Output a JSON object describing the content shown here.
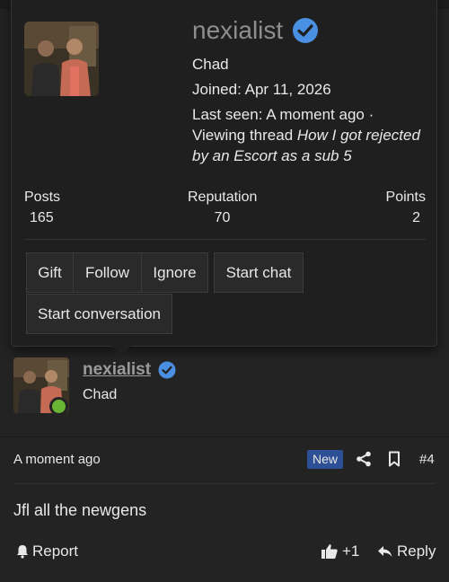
{
  "popup": {
    "username": "nexialist",
    "user_title": "Chad",
    "joined": "Joined: Apr 11, 2026",
    "last_seen_prefix": "Last seen: A moment ago ·",
    "viewing_prefix": "Viewing thread",
    "viewing_thread_line1": "How I got rejected",
    "viewing_thread_line2": "by an Escort as a sub 5",
    "stats": [
      {
        "label": "Posts",
        "value": "165"
      },
      {
        "label": "Reputation",
        "value": "70"
      },
      {
        "label": "Points",
        "value": "2"
      }
    ],
    "buttons": {
      "gift": "Gift",
      "follow": "Follow",
      "ignore": "Ignore",
      "start_chat": "Start chat",
      "start_conversation": "Start conversation"
    }
  },
  "post": {
    "username": "nexialist",
    "user_title": "Chad",
    "time": "A moment ago",
    "badge": "New",
    "post_number": "#4",
    "body": "Jfl all the newgens",
    "report_label": "Report",
    "like_count": "+1",
    "reply_label": "Reply"
  },
  "colors": {
    "background": "#232323",
    "popup_background": "#1f1f1f",
    "verified_blue": "#4a90e2",
    "online_green": "#6ab534",
    "new_badge": "#2d4f95"
  },
  "icons": [
    "verified-icon",
    "share-icon",
    "bookmark-icon",
    "flag-icon",
    "thumbs-up-icon",
    "reply-icon"
  ]
}
